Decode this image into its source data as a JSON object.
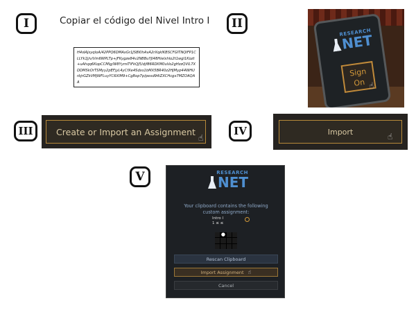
{
  "steps": {
    "one": "I",
    "two": "II",
    "three": "III",
    "four": "IV",
    "five": "V"
  },
  "panel_i": {
    "title": "Copiar el código del Nivel Intro I",
    "code": "H4sIAJsyqloA/42PPQ6DMAxGr1JSBI0hAvA2rXqkIKBSCFGITNQIFP1CLLYk1J/v/Vm6WPLTp+jFKygze84v2NBBuYJI48Hielxhlo2t1wgl1Kozt+uAhqq6KopCCMlg/W8YymlTiFkQJ5/djf86RDKM0uVo2gHzzQVlL7XDDMSkOrTSMyy2pEFjyL4yCfXe4Sdxs1bMX5BR40z2HJMyp44WHUrbjrGZkVMjWFLuyYC6XIM9+CgBop7p/pexd94iZXCHcgx7MZOAQAA"
  },
  "panel_ii": {
    "logo_small": "RESEARCH",
    "logo_big": "NET",
    "sign_line1": "Sign",
    "sign_line2": "On"
  },
  "panel_iii": {
    "button_label": "Create or Import an Assignment"
  },
  "panel_iv": {
    "button_label": "Import"
  },
  "panel_v": {
    "logo_small": "RESEARCH",
    "logo_big": "NET",
    "message": "Your clipboard contains the following custom assignment:",
    "assignment_name": "Intro I",
    "assignment_sub": "1 ≤ ≤",
    "rescan_label": "Rescan Clipboard",
    "import_label": "Import Assignment",
    "cancel_label": "Cancel"
  },
  "colors": {
    "gold": "#b88a3a",
    "logo_blue": "#4f8fd0",
    "dark_panel": "#262320"
  },
  "icons": [
    "cursor-hand-icon",
    "flask-logo-icon",
    "eye-icon"
  ]
}
